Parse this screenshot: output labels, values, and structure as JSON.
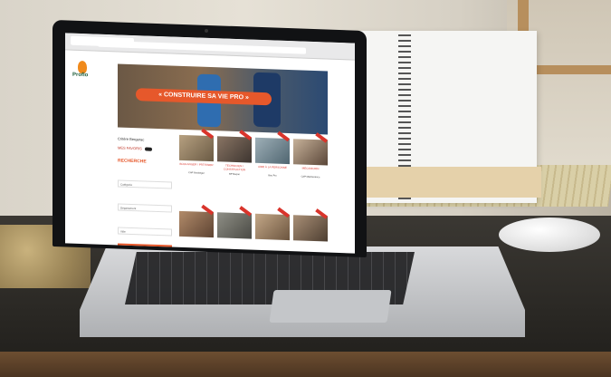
{
  "scene": {
    "description_items": [
      "laptop",
      "notebook",
      "mouse",
      "desk"
    ]
  },
  "screen": {
    "brand": "Proflo",
    "banner_text": "« CONSTRUIRE SA VIE PRO »",
    "sidebar": {
      "title": "Critère Bergerac",
      "toggle_label": "MES FAVORIS",
      "search_title": "RECHERCHE",
      "fields": [
        "Catégorie",
        "Département",
        "Ville"
      ]
    },
    "cards": [
      {
        "title": "BOULANGER / PÂTISSIER",
        "meta": "CAP Boulanger"
      },
      {
        "title": "TECHNICIEN / CONSTRUCTION",
        "meta": "BP Maçon"
      },
      {
        "title": "AIDE À LA PERSONNE",
        "meta": "Bac Pro"
      },
      {
        "title": "MÉCANICIEN",
        "meta": "CAP Maintenance"
      }
    ]
  },
  "colors": {
    "accent": "#e6582b",
    "brand_green": "#1f5d3b",
    "ribbon_red": "#d9342b"
  }
}
